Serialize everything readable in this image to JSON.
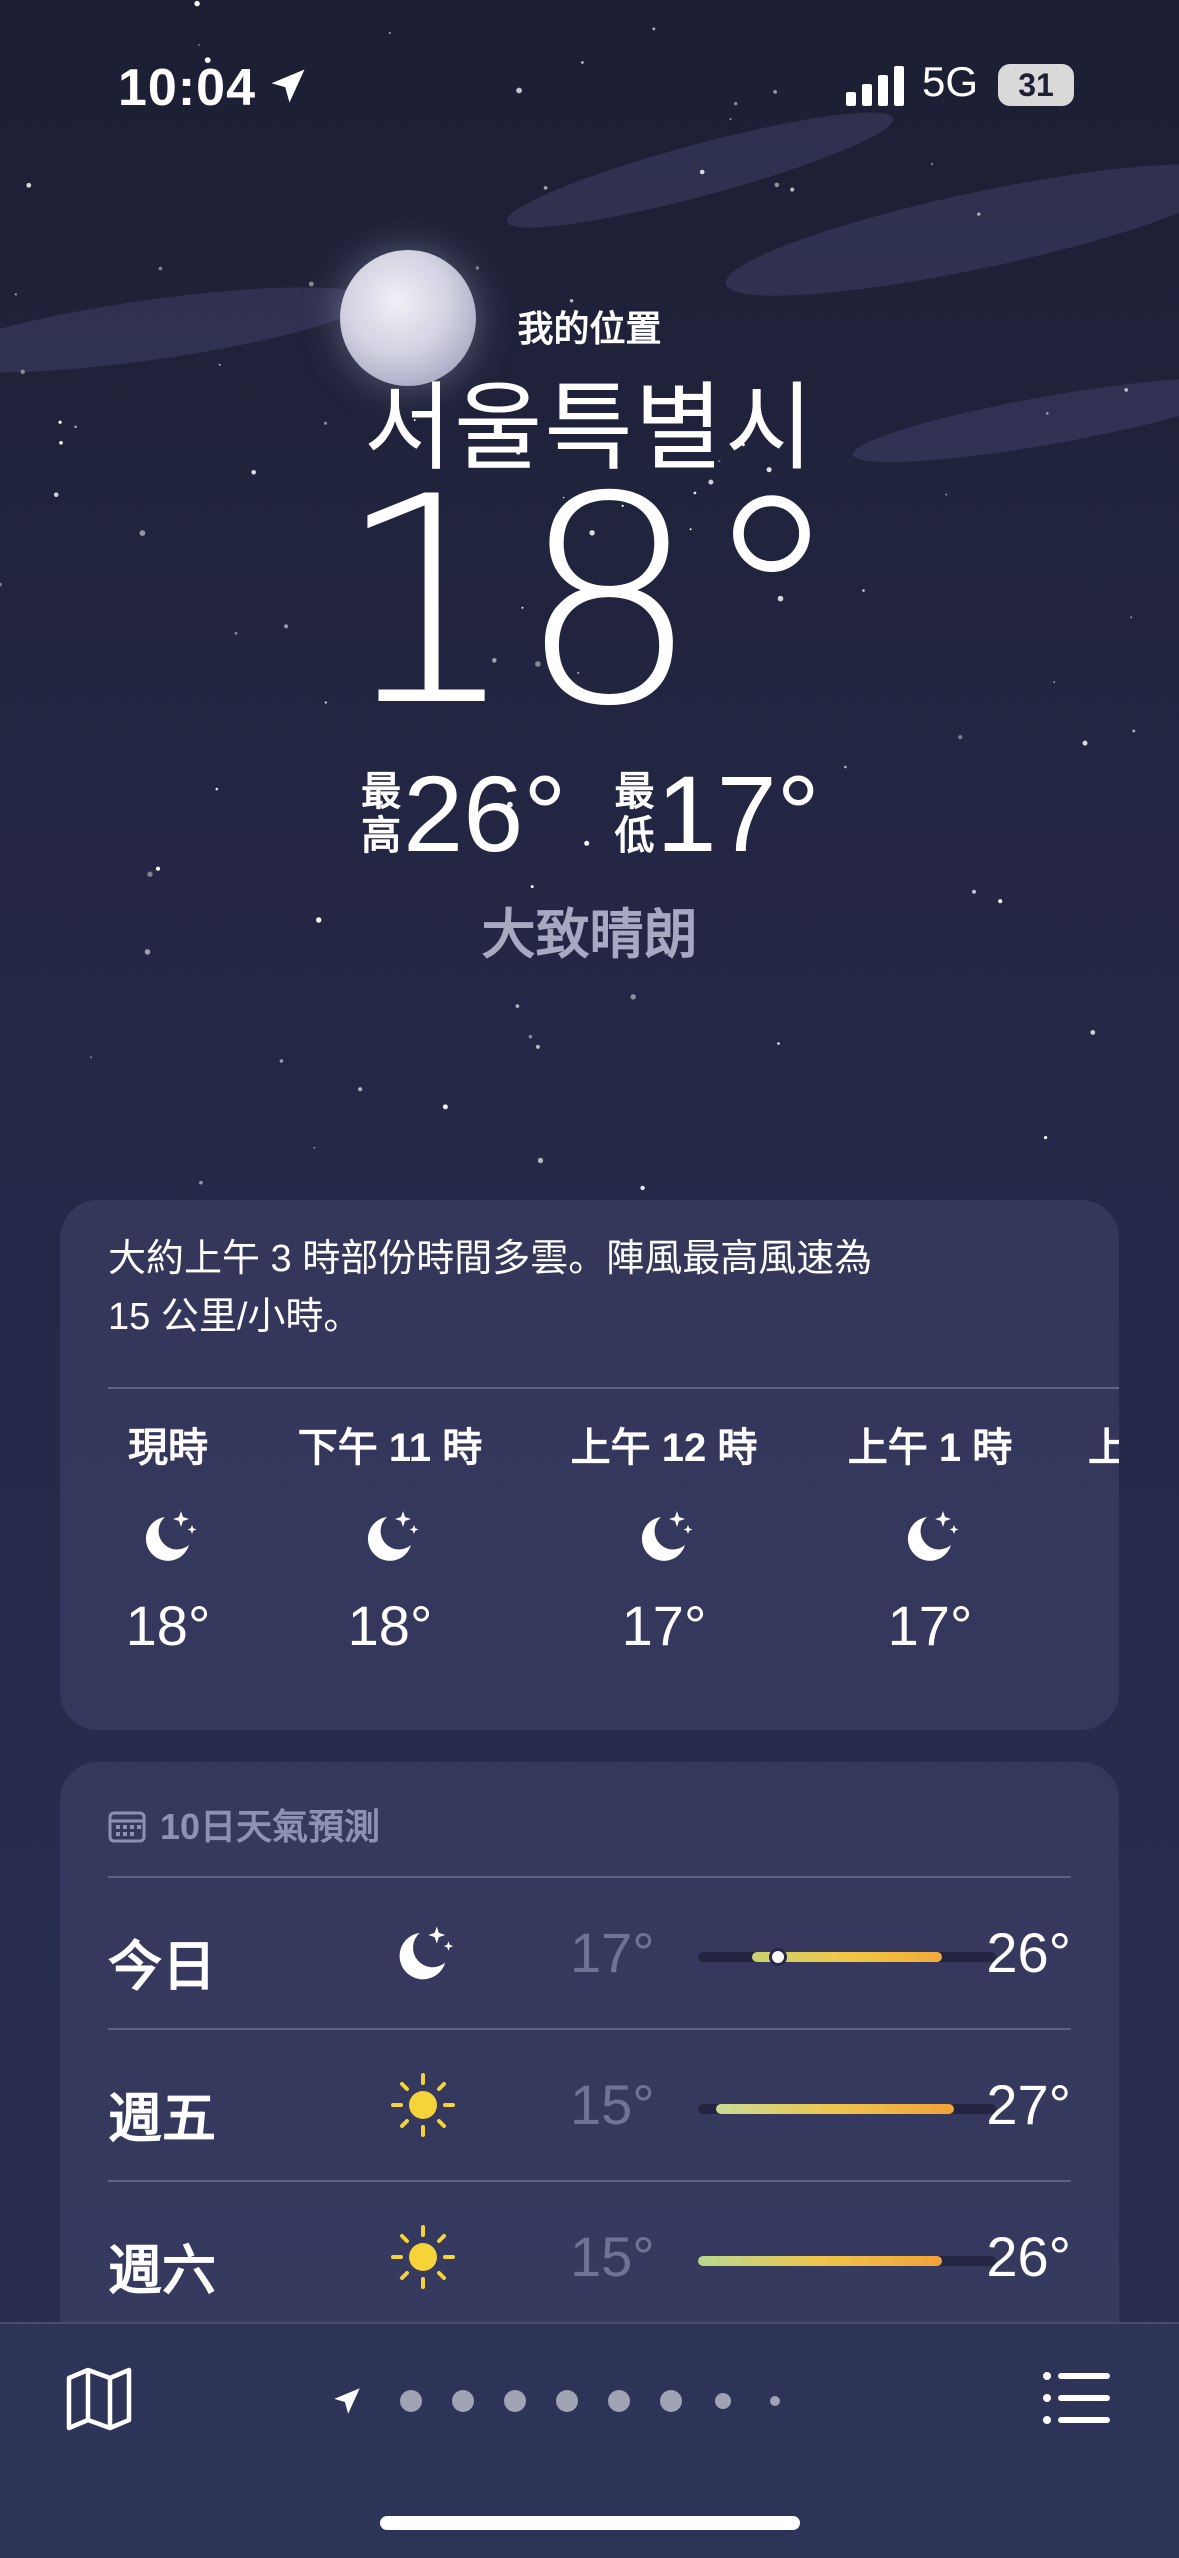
{
  "status_bar": {
    "time": "10:04",
    "network": "5G",
    "battery": "31"
  },
  "location": {
    "label": "我的位置",
    "city": "서울특별시"
  },
  "current": {
    "temp": "18°",
    "high_label": "最高",
    "high": "26°",
    "low_label": "最低",
    "low": "17°",
    "condition": "大致晴朗"
  },
  "hourly": {
    "summary_line1": "大約上午 3 時部份時間多雲。陣風最高風速為",
    "summary_line2": "15 公里/小時。",
    "items": [
      {
        "label": "現時",
        "icon": "moon-stars-icon",
        "temp": "18°"
      },
      {
        "label": "下午 11 時",
        "icon": "moon-stars-icon",
        "temp": "18°"
      },
      {
        "label": "上午 12 時",
        "icon": "moon-stars-icon",
        "temp": "17°"
      },
      {
        "label": "上午 1 時",
        "icon": "moon-stars-icon",
        "temp": "17°"
      },
      {
        "label": "上",
        "icon": "",
        "temp": ""
      }
    ]
  },
  "forecast": {
    "title": "10日天氣預測",
    "days": [
      {
        "day": "今日",
        "icon": "moon-stars-icon",
        "low": "17°",
        "high": "26°",
        "range_start": 0.18,
        "range_end": 0.82,
        "current_marker": 0.27,
        "colors": [
          "#c9d36b",
          "#f1c64a",
          "#f2aa3a"
        ]
      },
      {
        "day": "週五",
        "icon": "sun-icon",
        "low": "15°",
        "high": "27°",
        "range_start": 0.06,
        "range_end": 0.86,
        "colors": [
          "#c9dc95",
          "#eec54d",
          "#f2a23a"
        ]
      },
      {
        "day": "週六",
        "icon": "sun-icon",
        "low": "15°",
        "high": "26°",
        "range_start": 0.0,
        "range_end": 0.82,
        "colors": [
          "#b9d891",
          "#eec54d",
          "#f2a23a"
        ]
      }
    ]
  },
  "page_dot_count": 9,
  "colors": {
    "accent_sun": "#f7d33a",
    "muted_text": "#a7a8c2"
  }
}
